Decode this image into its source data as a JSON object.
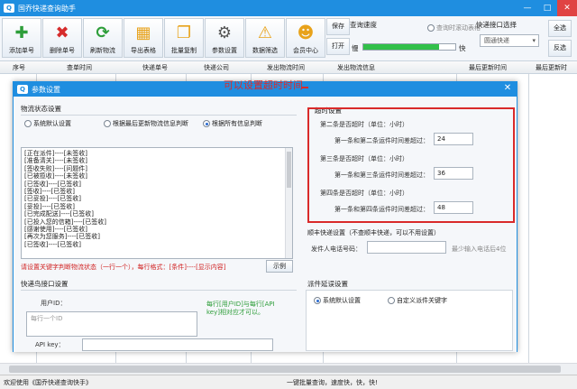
{
  "app": {
    "title": "国乔快递查询助手",
    "logo_text": "Q"
  },
  "toolbar": {
    "buttons": [
      {
        "label": "添加单号",
        "icon": "plus-icon",
        "color": "#2e9e3a"
      },
      {
        "label": "删除单号",
        "icon": "delete-x-icon",
        "color": "#d62c2c"
      },
      {
        "label": "刷新物流",
        "icon": "refresh-icon",
        "color": "#2e9e3a"
      },
      {
        "label": "导出表格",
        "icon": "export-folder-icon",
        "color": "#e8a21a"
      },
      {
        "label": "批量复制",
        "icon": "copy-icon",
        "color": "#e8a21a"
      },
      {
        "label": "参数设置",
        "icon": "gear-icon",
        "color": "#555555"
      },
      {
        "label": "数据筛选",
        "icon": "filter-icon",
        "color": "#e8a21a"
      },
      {
        "label": "会员中心",
        "icon": "user-icon",
        "color": "#e8a21a"
      }
    ],
    "save_label": "保存",
    "open_label": "打开",
    "speed_title": "查询速度",
    "speed_slow": "慢",
    "speed_fast": "快",
    "speed_level": 0.82,
    "scroll_table_label": "查询时滚动表格",
    "api_title": "快递接口选择",
    "api_selected": "圆通快递",
    "select_all_label": "全选",
    "invert_label": "反选"
  },
  "grid": {
    "columns": [
      "序号",
      "查单时间",
      "快递单号",
      "快递公司",
      "发出物流时间",
      "发出物流信息",
      "最后更新时间",
      "最后更新时"
    ]
  },
  "status": {
    "left": "欢迎使用《国乔快递查询快手》",
    "center": "一键批量查询，速度快，快，快!"
  },
  "annotation": "可以设置超时时间",
  "dialog": {
    "title": "参数设置",
    "logistics_section": "物流状态设置",
    "radio_options": [
      "系统默认设置",
      "根据最后更新物流信息判断",
      "根据所有信息判断"
    ],
    "radio_selected": 2,
    "rules": [
      "[正在派件]----[未签收]",
      "[准备清关]----[未签收]",
      "[签收失败]----[问题件]",
      "[已被揽收]----[未签收]",
      "[已签收]----[已签收]",
      "[签收]----[已签收]",
      "[已妥投]----[已签收]",
      "[妥投]----[已签收]",
      "[已完成配送]----[已签收]",
      "[已投入您的信箱]----[已签收]",
      "[感谢使用]----[已签收]",
      "[再次为您服务]----[已签收]",
      "[已签收]----[已签收]"
    ],
    "rules_hint": "请设置关键字判断物流状态（一行一个），每行格式：[条件]----[显示内容]",
    "example_label": "示例",
    "timeout_section": "超时设置",
    "timeout_groups": [
      {
        "title": "第二条是否超时（单位：小时）",
        "label": "第一条和第二条运件时间差超过：",
        "value": "24"
      },
      {
        "title": "第三条是否超时（单位：小时）",
        "label": "第一条和第三条运件时间差超过：",
        "value": "36"
      },
      {
        "title": "第四条是否超时（单位：小时）",
        "label": "第一条和第四条运件时间差超过：",
        "value": "48"
      }
    ],
    "sf_section": "顺丰快递设置（不查顺丰快递，可以不用设置）",
    "sf_phone_label": "发件人电话号码：",
    "sf_phone_hint": "最少输入电话后4位",
    "kdn_section": "快递鸟接口设置",
    "kdn_user_label": "用户ID：",
    "kdn_user_placeholder": "每行一个ID",
    "kdn_hint": "每行[用户ID]与每行[API key]相对应才可以。",
    "kdn_api_label": "API key：",
    "delay_section": "派件延误设置",
    "delay_options": [
      "系统默认设置",
      "自定义派件关键字"
    ],
    "delay_selected": 0
  }
}
